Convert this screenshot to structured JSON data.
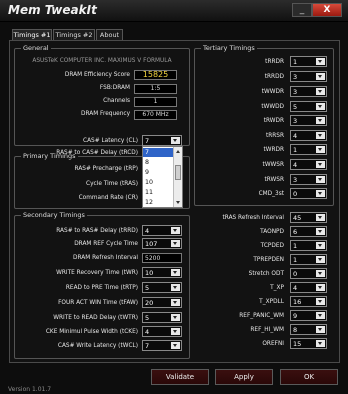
{
  "window": {
    "title": "Mem TweakIt",
    "minimize": "_",
    "close": "X"
  },
  "tabs": [
    "Timings #1",
    "Timings #2",
    "About"
  ],
  "general": {
    "heading": "General",
    "board": "ASUSTeK COMPUTER INC. MAXIMUS V FORMULA",
    "efficiency_label": "DRAM Efficiency Score",
    "efficiency_value": "15825",
    "fsb_label": "FSB:DRAM",
    "fsb_value": "1:5",
    "channels_label": "Channels",
    "channels_value": "1",
    "freq_label": "DRAM Frequency",
    "freq_value": "670 MHz"
  },
  "primary": {
    "heading": "Primary Timings",
    "rows": [
      {
        "label": "CAS# Latency (CL)",
        "value": "7"
      },
      {
        "label": "RAS# to CAS# Delay (tRCD)",
        "value": ""
      },
      {
        "label": "RAS# Precharge (tRP)",
        "value": ""
      },
      {
        "label": "Cycle Time (tRAS)",
        "value": ""
      },
      {
        "label": "Command Rate (CR)",
        "value": ""
      }
    ],
    "dropdown_options": [
      "7",
      "8",
      "9",
      "10",
      "11",
      "12"
    ]
  },
  "secondary": {
    "heading": "Secondary Timings",
    "rows": [
      {
        "label": "RAS# to RAS# Delay (tRRD)",
        "value": "4"
      },
      {
        "label": "DRAM REF Cycle Time",
        "value": "107"
      },
      {
        "label": "DRAM Refresh Interval",
        "value": "5200"
      },
      {
        "label": "WRITE Recovery Time (tWR)",
        "value": "10"
      },
      {
        "label": "READ to PRE Time (tRTP)",
        "value": "5"
      },
      {
        "label": "FOUR ACT WIN Time (tFAW)",
        "value": "20"
      },
      {
        "label": "WRITE to READ Delay (tWTR)",
        "value": "5"
      },
      {
        "label": "CKE Minimul Pulse Width (tCKE)",
        "value": "4"
      },
      {
        "label": "CAS# Write Latency (tWCL)",
        "value": "7"
      }
    ]
  },
  "tertiary": {
    "heading": "Tertiary Timings",
    "rows": [
      {
        "label": "tRRDR",
        "value": "1"
      },
      {
        "label": "tRRDD",
        "value": "3"
      },
      {
        "label": "tWWDR",
        "value": "3"
      },
      {
        "label": "tWWDD",
        "value": "5"
      },
      {
        "label": "tRWDR",
        "value": "3"
      },
      {
        "label": "tRRSR",
        "value": "4"
      },
      {
        "label": "tWRDR",
        "value": "1"
      },
      {
        "label": "tWWSR",
        "value": "4"
      },
      {
        "label": "tRWSR",
        "value": "3"
      },
      {
        "label": "CMD_3st",
        "value": "0"
      }
    ]
  },
  "misc": {
    "rows": [
      {
        "label": "tRAS Refresh Interval",
        "value": "45"
      },
      {
        "label": "TAONPD",
        "value": "6"
      },
      {
        "label": "TCPDED",
        "value": "1"
      },
      {
        "label": "TPREPDEN",
        "value": "1"
      },
      {
        "label": "Stretch ODT",
        "value": "0"
      },
      {
        "label": "T_XP",
        "value": "4"
      },
      {
        "label": "T_XPDLL",
        "value": "16"
      },
      {
        "label": "REF_PANIC_WM",
        "value": "9"
      },
      {
        "label": "REF_HI_WM",
        "value": "8"
      },
      {
        "label": "OREFNI",
        "value": "15"
      }
    ]
  },
  "buttons": {
    "validate": "Validate",
    "apply": "Apply",
    "ok": "OK"
  },
  "version": "Version 1.01.7"
}
